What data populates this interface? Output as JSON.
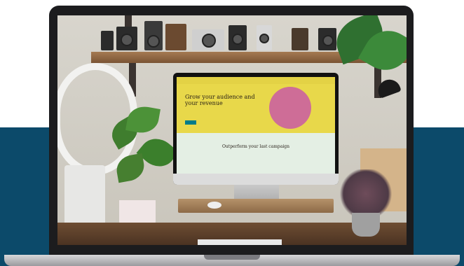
{
  "colors": {
    "band": "#0c4a6a",
    "shell": "#1c1c1e"
  },
  "monitor_page": {
    "headline": "Grow your audience and your revenue",
    "subheadline": "Outperform your last campaign"
  }
}
